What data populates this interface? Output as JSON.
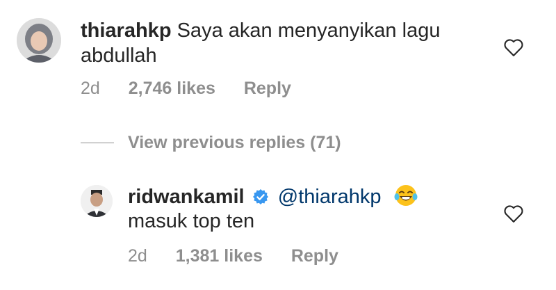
{
  "comment1": {
    "username": "thiarahkp",
    "text_line1": "Saya akan menyanyikan lagu",
    "text_line2": "abdullah",
    "time": "2d",
    "likes": "2,746 likes",
    "reply": "Reply"
  },
  "view_previous": "View previous replies (71)",
  "comment2": {
    "username": "ridwankamil",
    "mention": "@thiarahkp",
    "text_line2": "masuk top ten",
    "time": "2d",
    "likes": "1,381 likes",
    "reply": "Reply"
  },
  "colors": {
    "text": "#262626",
    "muted": "#8e8e8e",
    "verified": "#3897f0",
    "mention": "#00376b"
  }
}
